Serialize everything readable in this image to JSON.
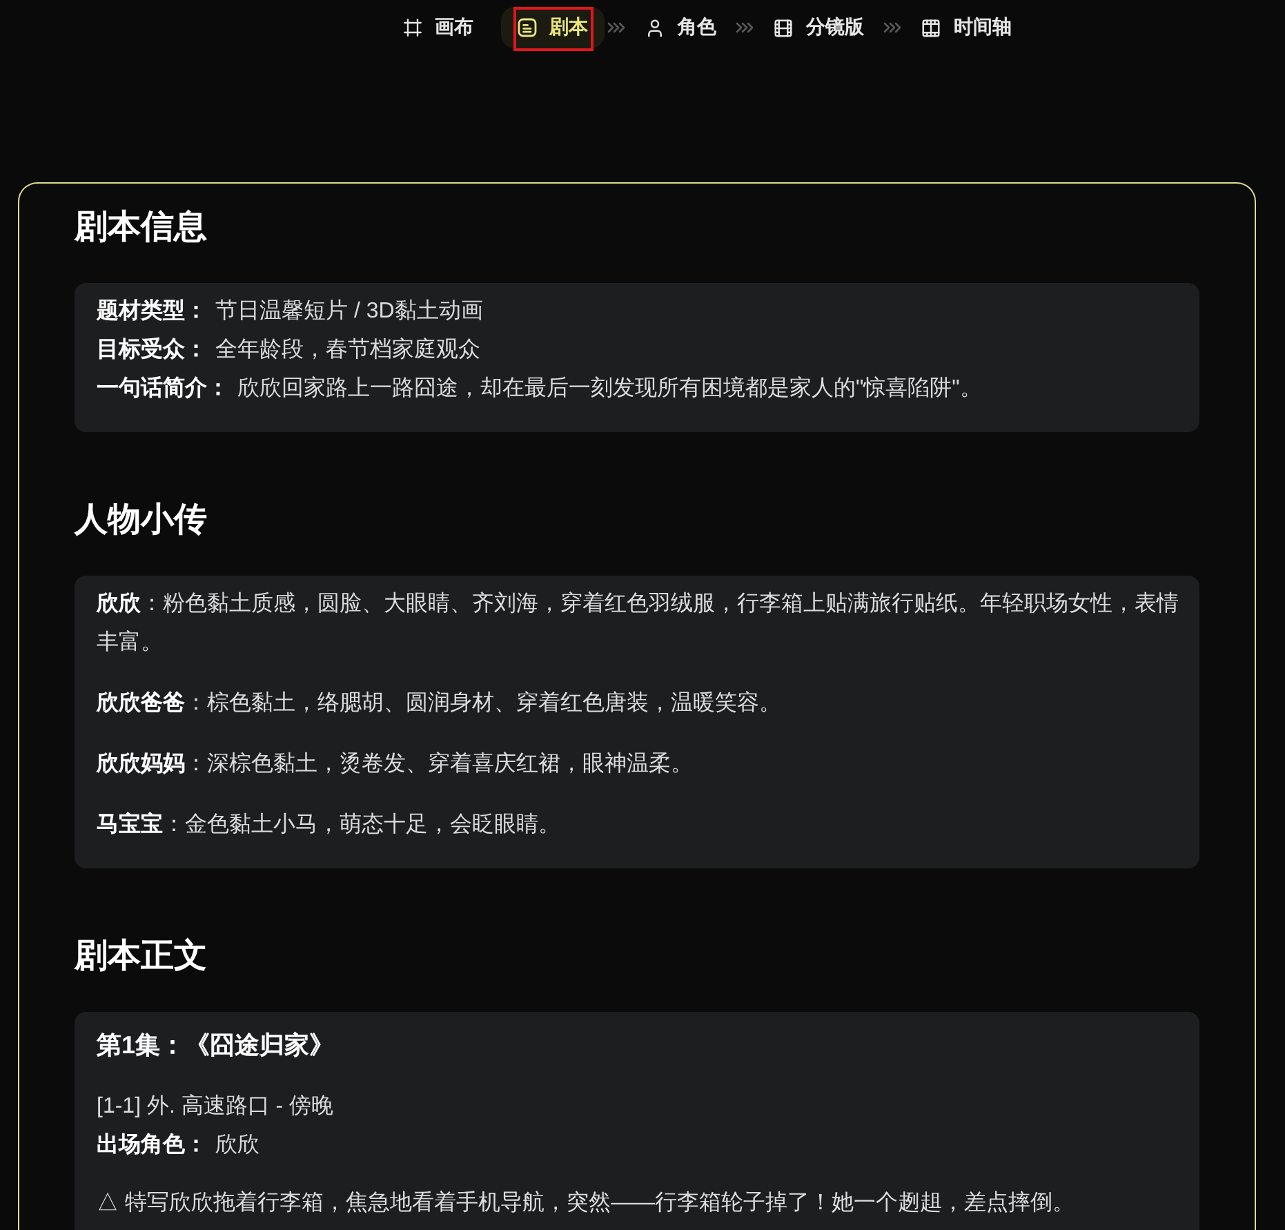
{
  "nav": {
    "tabs": [
      {
        "kind": "tool",
        "label": "画布",
        "selected": false,
        "highlighted": false
      },
      {
        "kind": "step",
        "label": "剧本",
        "selected": true,
        "highlighted": true
      },
      {
        "kind": "step",
        "label": "角色",
        "selected": false,
        "highlighted": false
      },
      {
        "kind": "step",
        "label": "分镜版",
        "selected": false,
        "highlighted": false
      },
      {
        "kind": "step",
        "label": "时间轴",
        "selected": false,
        "highlighted": false
      }
    ]
  },
  "sections": [
    {
      "kind": "fields",
      "title": "剧本信息",
      "fields": [
        {
          "label": "题材类型：",
          "value": "节日温馨短片 / 3D黏土动画"
        },
        {
          "label": "目标受众：",
          "value": "全年龄段，春节档家庭观众"
        },
        {
          "label": "一句话简介：",
          "value": "欣欣回家路上一路囧途，却在最后一刻发现所有困境都是家人的\"惊喜陷阱\"。"
        }
      ]
    },
    {
      "kind": "profiles",
      "title": "人物小传",
      "profiles": [
        "**欣欣**：粉色黏土质感，圆脸、大眼睛、齐刘海，穿着红色羽绒服，行李箱上贴满旅行贴纸。年轻职场女性，表情丰富。",
        "**欣欣爸爸**：棕色黏土，络腮胡、圆润身材、穿着红色唐装，温暖笑容。",
        "**欣欣妈妈**：深棕色黏土，烫卷发、穿着喜庆红裙，眼神温柔。",
        "**马宝宝**：金色黏土小马，萌态十足，会眨眼睛。"
      ]
    },
    {
      "kind": "episode",
      "title": "剧本正文",
      "episode": {
        "title": "第1集：《囧途归家》",
        "scene": "[1-1] 外. 高速路口 - 傍晚",
        "cast_label": "出场角色：",
        "cast": "欣欣",
        "action": "△ 特写欣欣拖着行李箱，焦急地看着手机导航，突然——行李箱轮子掉了！她一个趔趄，差点摔倒。"
      }
    }
  ]
}
